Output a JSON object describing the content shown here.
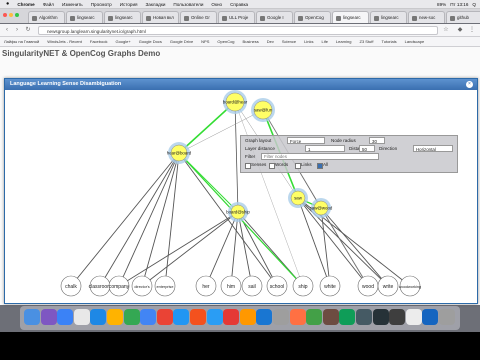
{
  "menubar": {
    "app": "Chrome",
    "items": [
      "Файл",
      "Изменить",
      "Просмотр",
      "История",
      "Закладки",
      "Пользователи",
      "Окно",
      "Справка"
    ],
    "right": [
      "89%",
      "Пт 13:16",
      "Q"
    ]
  },
  "tabs": [
    {
      "label": "Algorithm"
    },
    {
      "label": "lingsearc"
    },
    {
      "label": "lingsearc"
    },
    {
      "label": "Новая вкл"
    },
    {
      "label": "Online Gr"
    },
    {
      "label": "ULL Proje"
    },
    {
      "label": "Google I"
    },
    {
      "label": "OpenCog"
    },
    {
      "label": "lingsearc"
    },
    {
      "label": "lingsearc"
    },
    {
      "label": "new-soc"
    },
    {
      "label": "github"
    }
  ],
  "url": "newsgroup.langlearn.singularitynet.io/graph.html",
  "bookmarks": [
    "Лайфы на Главной",
    "WindsJets - Recent",
    "Facebook",
    "Google+",
    "Google Docs",
    "Google Drive",
    "NPS",
    "OpenCog",
    "Business",
    "Dev",
    "Science",
    "Links",
    "Life",
    "Learning",
    "Z3 Stuff",
    "Tutorials",
    "Landscape"
  ],
  "page_title": "SingularityNET & OpenCog Graphs Demo",
  "modal": {
    "title": "Language Learning Sense Disambiguation",
    "close": "×"
  },
  "graph": {
    "top_nodes": [
      {
        "label": "board@hear"
      },
      {
        "label": "saw@fun"
      }
    ],
    "mid_nodes": [
      {
        "label": "hear@board"
      },
      {
        "label": "board@ship"
      },
      {
        "label": "saw"
      },
      {
        "label": "saw@wood"
      }
    ],
    "words": [
      "chalk",
      "classroom",
      "company",
      "director's",
      "enterprise",
      "her",
      "him",
      "sail",
      "school",
      "ship",
      "white",
      "wood",
      "write",
      "woodworking"
    ]
  },
  "panel": {
    "graph_label": "Graph layout",
    "graph_value": "Force",
    "node_radius_label": "Node radius",
    "node_radius_value": "30",
    "link_distance_label": "Layer distance",
    "link_distance_value": "1",
    "distance_label": "Distance",
    "distance_value": "50",
    "direction_label": "Direction",
    "direction_value": "Horizontal",
    "filter_label": "Filter",
    "filter_placeholder": "Filter nodes",
    "options": [
      "Senses",
      "Words",
      "Links",
      "All"
    ]
  },
  "colors": {
    "accent": "#3a6fb0",
    "node_fill": "#ffff66",
    "link_green": "#33dd33",
    "link_gray": "#555555"
  }
}
